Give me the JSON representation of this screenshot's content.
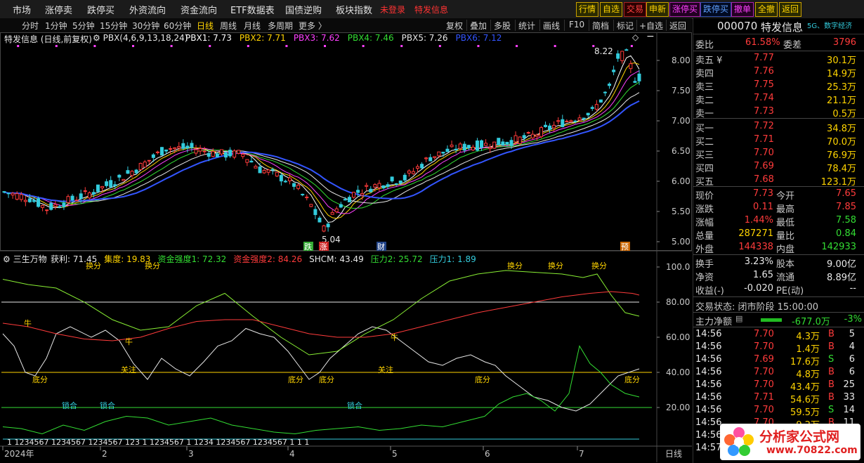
{
  "topmenu": {
    "items": [
      "市场",
      "涨停卖",
      "跌停买",
      "外资流向",
      "资金流向",
      "ETF数据表",
      "国债逆购",
      "板块指数"
    ],
    "stock_tag1": "未登录",
    "stock_tag2": "特发信息",
    "buttons": [
      "行情",
      "自选",
      "交易",
      "申新",
      "涨停买",
      "跌停买",
      "撤单",
      "全撤",
      "返回"
    ]
  },
  "toolbar": {
    "periods": [
      "分时",
      "1分钟",
      "5分钟",
      "15分钟",
      "30分钟",
      "60分钟",
      "日线",
      "周线",
      "月线",
      "多周期",
      "更多 〉"
    ],
    "selected_period": "日线",
    "right": [
      "复权",
      "叠加",
      "多股",
      "统计",
      "画线",
      "F10",
      "简档",
      "标记",
      "+自选",
      "返回"
    ]
  },
  "main_header": {
    "name": "特发信息 (日线,前复权)",
    "indicator": "PBX(4,6,9,13,18,24)",
    "lines": [
      {
        "label": "PBX1: 7.73",
        "color": "#ffffff"
      },
      {
        "label": "PBX2: 7.71",
        "color": "#ffd400"
      },
      {
        "label": "PBX3: 7.62",
        "color": "#ff40ff"
      },
      {
        "label": "PBX4: 7.46",
        "color": "#33dd33"
      },
      {
        "label": "PBX5: 7.26",
        "color": "#e8e8e8"
      },
      {
        "label": "PBX6: 7.12",
        "color": "#3355ff"
      }
    ]
  },
  "sub_header": {
    "name": "三生万物",
    "items": [
      {
        "label": "获利: 71.45",
        "color": "#e8e8e8"
      },
      {
        "label": "集度: 19.83",
        "color": "#ffd400"
      },
      {
        "label": "资金强度1: 72.32",
        "color": "#33dd33"
      },
      {
        "label": "资金强度2: 84.26",
        "color": "#ff3b3b"
      },
      {
        "label": "SHCM: 43.49",
        "color": "#e8e8e8"
      },
      {
        "label": "压力2: 25.72",
        "color": "#33dd33"
      },
      {
        "label": "压力1: 1.89",
        "color": "#33ccdd"
      }
    ]
  },
  "price_axis": [
    "8.00",
    "7.50",
    "7.00",
    "6.50",
    "6.00",
    "5.50",
    "5.00"
  ],
  "sub_axis": [
    "100.0",
    "80.00",
    "60.00",
    "40.00",
    "20.00"
  ],
  "date_axis": [
    "2024年",
    "2",
    "3",
    "4",
    "5",
    "6",
    "7"
  ],
  "date_axis_right": "日线",
  "annotations": {
    "high_price": "8.22",
    "low_price": "5.04",
    "low_markers": [
      "跌",
      "涨",
      "财"
    ],
    "pre_marker": "预",
    "sub_labels": [
      "牛",
      "牛",
      "牛",
      "关注",
      "关注",
      "底分",
      "底分",
      "底分",
      "底分",
      "底分",
      "锁合",
      "锁合",
      "锁合",
      "换分",
      "换分",
      "换分",
      "换分",
      "换分"
    ],
    "bottom_row": "1 1234567 1234567 1234567 123 1 1234567 1 1234 1234567 1234567 1 1 1"
  },
  "right_panel": {
    "code": "000070",
    "name": "特发信息",
    "sector": "5G、数字经济",
    "weibi_label": "委比",
    "weibi": "61.58%",
    "weicha_label": "委差",
    "weicha": "3796",
    "asks": [
      {
        "label": "卖五 ¥",
        "price": "7.77",
        "vol": "30.1万"
      },
      {
        "label": "卖四",
        "price": "7.76",
        "vol": "14.9万"
      },
      {
        "label": "卖三",
        "price": "7.75",
        "vol": "25.3万"
      },
      {
        "label": "卖二",
        "price": "7.74",
        "vol": "21.1万"
      },
      {
        "label": "卖一",
        "price": "7.73",
        "vol": "0.5万"
      }
    ],
    "bids": [
      {
        "label": "买一",
        "price": "7.72",
        "vol": "34.8万"
      },
      {
        "label": "买二",
        "price": "7.71",
        "vol": "70.0万"
      },
      {
        "label": "买三",
        "price": "7.70",
        "vol": "76.9万"
      },
      {
        "label": "买四",
        "price": "7.69",
        "vol": "78.4万"
      },
      {
        "label": "买五",
        "price": "7.68",
        "vol": "123.1万"
      }
    ],
    "stats": [
      {
        "l1": "现价",
        "v1": "7.73",
        "c1": "red",
        "l2": "今开",
        "v2": "7.65",
        "c2": "red"
      },
      {
        "l1": "涨跌",
        "v1": "0.11",
        "c1": "red",
        "l2": "最高",
        "v2": "7.85",
        "c2": "red"
      },
      {
        "l1": "涨幅",
        "v1": "1.44%",
        "c1": "red",
        "l2": "最低",
        "v2": "7.58",
        "c2": "grn"
      },
      {
        "l1": "总量",
        "v1": "287271",
        "c1": "yel",
        "l2": "量比",
        "v2": "0.84",
        "c2": "grn"
      },
      {
        "l1": "外盘",
        "v1": "144338",
        "c1": "red",
        "l2": "内盘",
        "v2": "142933",
        "c2": "grn"
      }
    ],
    "stats2": [
      {
        "l1": "换手",
        "v1": "3.23%",
        "l2": "股本",
        "v2": "9.00亿"
      },
      {
        "l1": "净资",
        "v1": "1.65",
        "l2": "流通",
        "v2": "8.89亿"
      },
      {
        "l1": "收益(-)",
        "v1": "-0.020",
        "l2": "PE(动)",
        "v2": "--"
      }
    ],
    "trade_status": "交易状态: 闭市阶段 15:00:00",
    "main_flow_label": "主力净额",
    "main_flow_value": "-677.0万",
    "main_flow_pct": "-3%",
    "ticks": [
      {
        "t": "14:56",
        "p": "7.70",
        "v": "4.3万",
        "d": "B",
        "n": "5"
      },
      {
        "t": "14:56",
        "p": "7.70",
        "v": "1.4万",
        "d": "B",
        "n": "4"
      },
      {
        "t": "14:56",
        "p": "7.69",
        "v": "17.6万",
        "d": "S",
        "n": "6"
      },
      {
        "t": "14:56",
        "p": "7.70",
        "v": "4.8万",
        "d": "B",
        "n": "6"
      },
      {
        "t": "14:56",
        "p": "7.70",
        "v": "43.4万",
        "d": "B",
        "n": "25"
      },
      {
        "t": "14:56",
        "p": "7.71",
        "v": "54.6万",
        "d": "B",
        "n": "33"
      },
      {
        "t": "14:56",
        "p": "7.70",
        "v": "59.5万",
        "d": "S",
        "n": "14"
      },
      {
        "t": "14:56",
        "p": "7.70",
        "v": "9.2万",
        "d": "B",
        "n": "11"
      },
      {
        "t": "14:56",
        "p": "",
        "v": "",
        "d": "",
        "n": ""
      },
      {
        "t": "14:57",
        "p": "",
        "v": "",
        "d": "",
        "n": ""
      }
    ]
  },
  "watermark": {
    "site": "分析家公式网",
    "url": "www.70822.com"
  },
  "colors": {
    "up": "#ff3b3b",
    "down": "#33ccdd",
    "yellow": "#ffd400",
    "green": "#33dd33"
  }
}
